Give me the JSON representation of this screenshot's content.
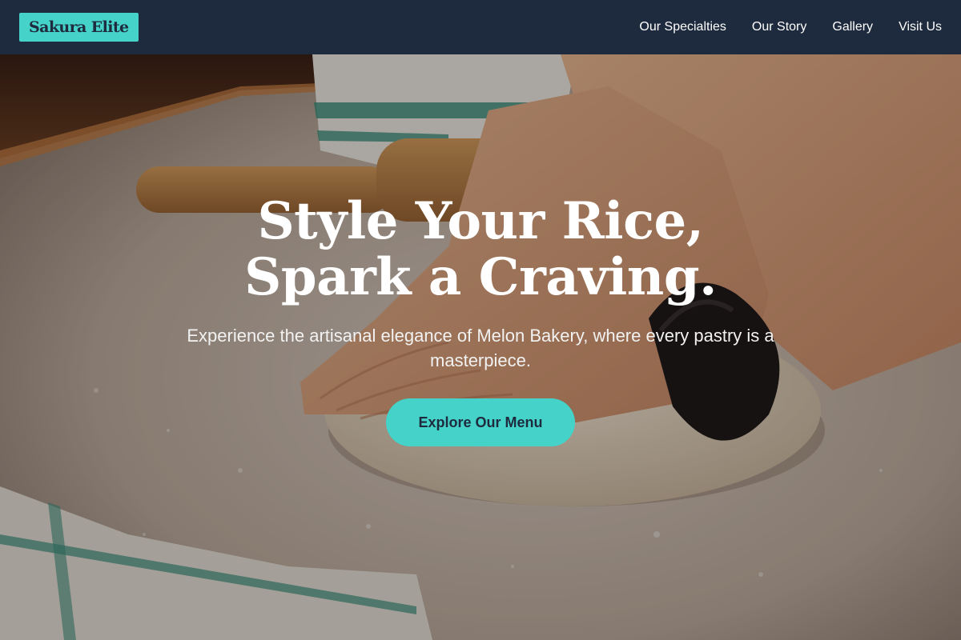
{
  "header": {
    "logo_text": "Sakura Elite",
    "nav": [
      {
        "label": "Our Specialties"
      },
      {
        "label": "Our Story"
      },
      {
        "label": "Gallery"
      },
      {
        "label": "Visit Us"
      }
    ]
  },
  "hero": {
    "title_line1": "Style Your Rice,",
    "title_line2": "Spark a Craving.",
    "subtitle": "Experience the artisanal elegance of Melon Bakery, where every pastry is a masterpiece.",
    "cta_label": "Explore Our Menu"
  },
  "colors": {
    "header_bg": "#1e2a3d",
    "accent": "#45d2c9",
    "text_light": "#ffffff"
  }
}
